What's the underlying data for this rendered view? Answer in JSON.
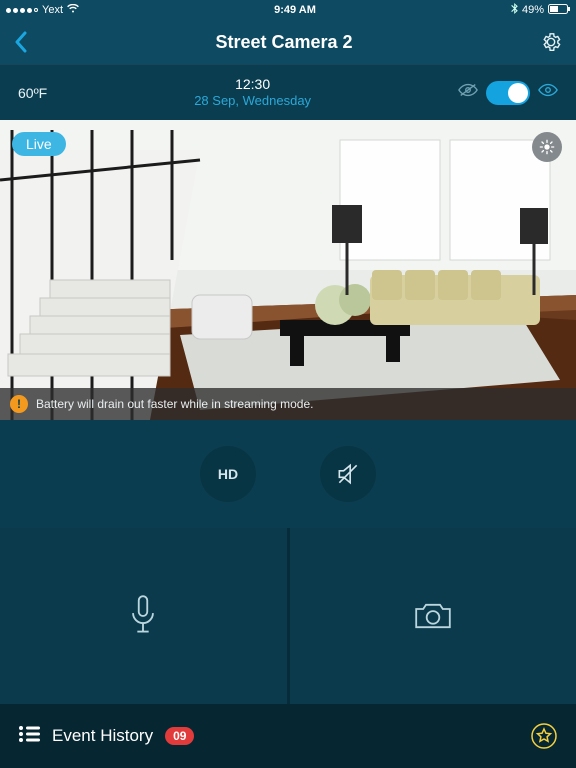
{
  "status": {
    "carrier": "Yext",
    "time": "9:49 AM",
    "battery": "49%"
  },
  "nav": {
    "title": "Street Camera 2"
  },
  "info": {
    "temperature": "60ºF",
    "time": "12:30",
    "date": "28 Sep, Wednesday"
  },
  "camera": {
    "live_label": "Live",
    "warning": "Battery will drain out faster while in streaming mode."
  },
  "controls": {
    "hd_label": "HD"
  },
  "footer": {
    "event_label": "Event History",
    "event_count": "09"
  },
  "colors": {
    "accent": "#15a3e0",
    "brand_bg": "#0b3d50"
  }
}
